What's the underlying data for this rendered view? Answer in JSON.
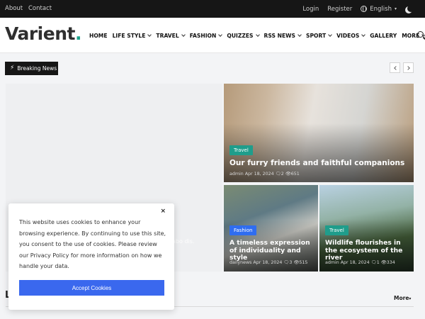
{
  "topbar": {
    "about": "About",
    "contact": "Contact",
    "login": "Login",
    "register": "Register",
    "language": "English"
  },
  "header": {
    "logo_text": "Varient",
    "logo_dot": ".",
    "nav": [
      {
        "label": "HOME",
        "dropdown": false
      },
      {
        "label": "LIFE STYLE",
        "dropdown": true
      },
      {
        "label": "TRAVEL",
        "dropdown": true
      },
      {
        "label": "FASHION",
        "dropdown": true
      },
      {
        "label": "QUIZZES",
        "dropdown": true
      },
      {
        "label": "RSS NEWS",
        "dropdown": true
      },
      {
        "label": "SPORT",
        "dropdown": true
      },
      {
        "label": "VIDEOS",
        "dropdown": true
      },
      {
        "label": "GALLERY",
        "dropdown": false
      },
      {
        "label": "MORE",
        "dropdown": true
      }
    ]
  },
  "breaking": {
    "label": "Breaking News"
  },
  "hero_left": {
    "partial_text": "abo dis."
  },
  "cards": [
    {
      "category": "Travel",
      "badge_color": "#1f9d8b",
      "title": "Our furry friends and faithful companions",
      "author": "admin",
      "date": "Apr 18, 2024",
      "comments": "2",
      "views": "651"
    },
    {
      "category": "Fashion",
      "badge_color": "#2f6df0",
      "title": "A timeless expression of individuality and style",
      "author": "dailynews",
      "date": "Apr 18, 2024",
      "comments": "3",
      "views": "515"
    },
    {
      "category": "Travel",
      "badge_color": "#1f9d8b",
      "title": "Wildlife flourishes in the ecosystem of the river",
      "author": "admin",
      "date": "Apr 18, 2024",
      "comments": "1",
      "views": "334"
    }
  ],
  "cookie": {
    "text": "This website uses cookies to enhance your browsing experience. By continuing to use this site, you consent to the use of cookies. Please review our Privacy Policy for more information on how we handle your data.",
    "close": "×",
    "accept": "Accept Cookies"
  },
  "section": {
    "partial_title": "L",
    "more": "More"
  },
  "colors": {
    "accent": "#1aa28a",
    "button": "#3a68ee",
    "topbar": "#161616"
  }
}
